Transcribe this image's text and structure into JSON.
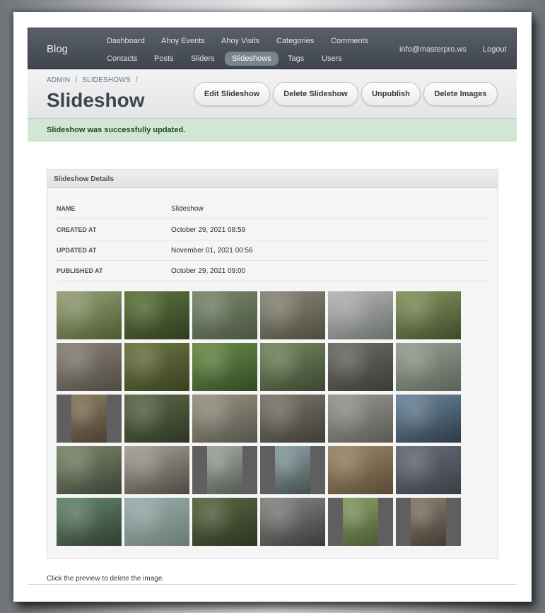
{
  "navbar": {
    "brand": "Blog",
    "top_row": [
      "Dashboard",
      "Ahoy Events",
      "Ahoy Visits",
      "Categories",
      "Comments"
    ],
    "bottom_row": [
      "Contacts",
      "Posts",
      "Sliders",
      "Slideshows",
      "Tags",
      "Users"
    ],
    "active_item": "Slideshows",
    "user_email": "info@masterpro.ws",
    "logout_label": "Logout"
  },
  "breadcrumb": [
    "ADMIN",
    "/",
    "SLIDESHOWS",
    "/"
  ],
  "page_title": "Slideshow",
  "actions": [
    "Edit Slideshow",
    "Delete Slideshow",
    "Unpublish",
    "Delete Images"
  ],
  "alert": "Slideshow was successfully updated.",
  "details": {
    "header": "Slideshow Details",
    "rows": [
      {
        "label": "NAME",
        "value": "Slideshow"
      },
      {
        "label": "CREATED AT",
        "value": "October 29, 2021 08:59"
      },
      {
        "label": "UPDATED AT",
        "value": "November 01, 2021 00:56"
      },
      {
        "label": "PUBLISHED AT",
        "value": "October 29, 2021 09:00"
      }
    ]
  },
  "images": {
    "columns": 6,
    "rows": 5,
    "tiles": [
      {
        "c1": "#9aa37a",
        "c2": "#4c5a2e"
      },
      {
        "c1": "#5e7a3c",
        "c2": "#2f3b22"
      },
      {
        "c1": "#7b8a6e",
        "c2": "#4a5340"
      },
      {
        "c1": "#8d8c7a",
        "c2": "#4c4a3e"
      },
      {
        "c1": "#b7b9b5",
        "c2": "#6a6e6a"
      },
      {
        "c1": "#8a9860",
        "c2": "#3e4a2a"
      },
      {
        "c1": "#8a8377",
        "c2": "#4f4a42"
      },
      {
        "c1": "#6f7844",
        "c2": "#384020"
      },
      {
        "c1": "#6e8f4a",
        "c2": "#2f4a24"
      },
      {
        "c1": "#7a8a62",
        "c2": "#3a4630"
      },
      {
        "c1": "#6f6f6a",
        "c2": "#3a3a36"
      },
      {
        "c1": "#9aa094",
        "c2": "#5a6258"
      },
      {
        "c1": "#8c7d62",
        "c2": "#4a4032",
        "narrow": true
      },
      {
        "c1": "#5e6b4a",
        "c2": "#2e3624"
      },
      {
        "c1": "#9a9686",
        "c2": "#55534a"
      },
      {
        "c1": "#7d7a6e",
        "c2": "#3e3c34"
      },
      {
        "c1": "#9a9a94",
        "c2": "#5a5a54"
      },
      {
        "c1": "#6e8aa0",
        "c2": "#2c3a44"
      },
      {
        "c1": "#7f8a6e",
        "c2": "#3a4234"
      },
      {
        "c1": "#a8a49a",
        "c2": "#4c4840"
      },
      {
        "c1": "#a4a8a2",
        "c2": "#565a54",
        "narrow": true
      },
      {
        "c1": "#8fa4a8",
        "c2": "#44504e",
        "narrow": true
      },
      {
        "c1": "#9c8a6a",
        "c2": "#5a4a34"
      },
      {
        "c1": "#6a6e7a",
        "c2": "#3c3e46"
      },
      {
        "c1": "#6a8a6e",
        "c2": "#2e3e30"
      },
      {
        "c1": "#9ab0b0",
        "c2": "#6a7a70"
      },
      {
        "c1": "#5a6a44",
        "c2": "#2c3420"
      },
      {
        "c1": "#8a8a88",
        "c2": "#3a3a38"
      },
      {
        "c1": "#8aa066",
        "c2": "#4a5a34",
        "narrow": true
      },
      {
        "c1": "#8a8070",
        "c2": "#443c34",
        "narrow": true
      }
    ]
  },
  "footer_note": "Click the preview to delete the image."
}
